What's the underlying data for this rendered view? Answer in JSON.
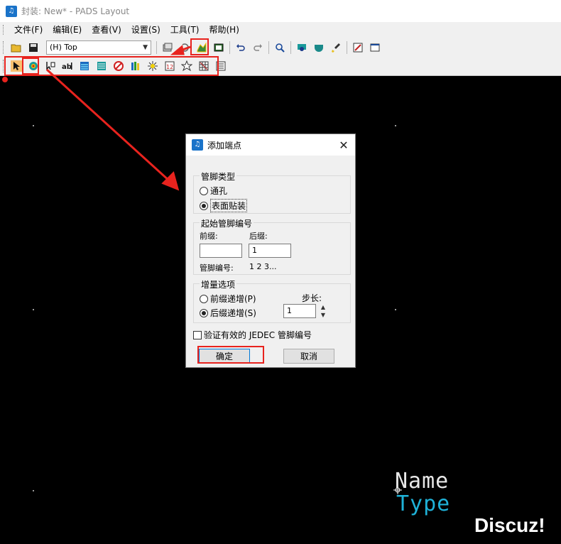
{
  "window": {
    "title": "封装: New* - PADS Layout",
    "app_icon": "pads-icon"
  },
  "menu": {
    "items": [
      {
        "label": "文件(F)",
        "name": "menu-file"
      },
      {
        "label": "编辑(E)",
        "name": "menu-edit"
      },
      {
        "label": "查看(V)",
        "name": "menu-view"
      },
      {
        "label": "设置(S)",
        "name": "menu-setup"
      },
      {
        "label": "工具(T)",
        "name": "menu-tools"
      },
      {
        "label": "帮助(H)",
        "name": "menu-help"
      }
    ]
  },
  "toolbar1": {
    "layer_select_value": "(H) Top"
  },
  "dialog": {
    "title": "添加端点",
    "pin_type": {
      "label": "管脚类型",
      "options": [
        {
          "label": "通孔",
          "selected": false
        },
        {
          "label": "表面贴装",
          "selected": true
        }
      ]
    },
    "start_pin": {
      "label": "起始管脚编号",
      "prefix_label": "前缀:",
      "suffix_label": "后缀:",
      "prefix_value": "",
      "suffix_value": "1",
      "pin_numbers_label": "管脚编号:",
      "pin_numbers_value": "1 2 3..."
    },
    "increment": {
      "label": "增量选项",
      "options": [
        {
          "label": "前缀递增(P)",
          "selected": false
        },
        {
          "label": "后缀递增(S)",
          "selected": true
        }
      ],
      "step_label": "步长:",
      "step_value": "1"
    },
    "verify_label": "验证有效的 JEDEC 管脚编号",
    "verify_checked": false,
    "ok_label": "确定",
    "cancel_label": "取消"
  },
  "watermark": {
    "name": "Name",
    "type": "Type",
    "discuz": "Discuz!"
  },
  "colors": {
    "annotation": "#e8231e",
    "canvas": "#000000",
    "watermark_type": "#1fb2d8"
  }
}
